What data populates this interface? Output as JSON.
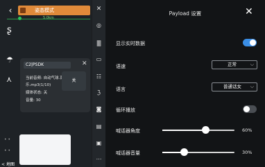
{
  "left": {
    "status_text": "姿态模式",
    "gps_distance": "5.0km",
    "map_label": "地图"
  },
  "card": {
    "title": "C2|PSDK",
    "line1": "当前音频: 自动气球.南杰",
    "line2": "乐.mp3(1/10)",
    "line3": "媒体状态: 关",
    "line4": "音量: 30",
    "stop_label": "关"
  },
  "panel": {
    "title": "Payload 设置",
    "rows": {
      "realtime_label": "显示实时数据",
      "realtime_on": true,
      "speed_label": "语速",
      "speed_value": "正常",
      "voice_label": "语言",
      "voice_value": "普通话女",
      "loop_label": "循环播放",
      "loop_on": false,
      "angle_label": "喊话器角度",
      "angle_value": 60,
      "angle_pct": "60%",
      "volume_label": "喊话器音量",
      "volume_value": 30,
      "volume_pct": "30%"
    }
  },
  "colors": {
    "accent": "#3a8ee6",
    "status": "#e08a3a"
  }
}
